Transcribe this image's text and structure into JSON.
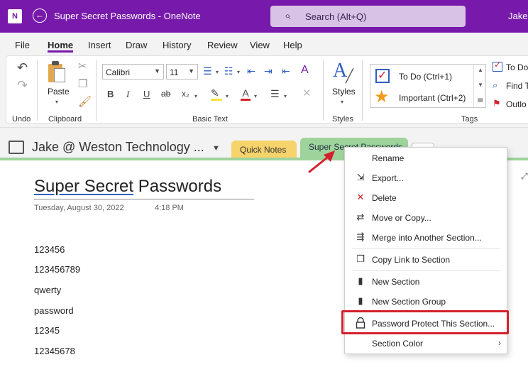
{
  "titlebar": {
    "logo": "N",
    "title": "Super Secret Passwords  -  OneNote",
    "search_placeholder": "Search (Alt+Q)",
    "user": "Jake C"
  },
  "menu": {
    "items": [
      "File",
      "Home",
      "Insert",
      "Draw",
      "History",
      "Review",
      "View",
      "Help"
    ],
    "active": "Home"
  },
  "ribbon": {
    "groups": {
      "undo": "Undo",
      "clipboard": "Clipboard",
      "basic_text": "Basic Text",
      "styles": "Styles",
      "tags": "Tags"
    },
    "paste_label": "Paste",
    "styles_label": "Styles",
    "font_name": "Calibri",
    "font_size": "11",
    "tags": {
      "todo": "To Do (Ctrl+1)",
      "important": "Important (Ctrl+2)"
    },
    "right_items": {
      "todo_tag": "To Do",
      "find_tags": "Find T",
      "outlook": "Outlo"
    }
  },
  "notebook": {
    "name": "Jake @ Weston Technology ...",
    "tabs": {
      "quick_notes": "Quick Notes",
      "secret": "Super Secret Passwords"
    },
    "colors": {
      "quick_notes": "#f6d36b",
      "secret": "#9fd39c"
    }
  },
  "page": {
    "title_part1": "Super Secret",
    "title_part2": " Passwords",
    "date": "Tuesday, August 30, 2022",
    "time": "4:18 PM",
    "lines": [
      "123456",
      "123456789",
      "qwerty",
      "password",
      "12345",
      "12345678"
    ]
  },
  "context_menu": {
    "items": [
      {
        "label": "Rename",
        "icon": "none"
      },
      {
        "label": "Export...",
        "icon": "export-icon"
      },
      {
        "label": "Delete",
        "icon": "delete-x-icon"
      },
      {
        "label": "Move or Copy...",
        "icon": "move-icon"
      },
      {
        "label": "Merge into Another Section...",
        "icon": "merge-icon"
      },
      {
        "label": "Copy Link to Section",
        "icon": "link-icon"
      },
      {
        "label": "New Section",
        "icon": "section-icon"
      },
      {
        "label": "New Section Group",
        "icon": "section-group-icon"
      },
      {
        "label": "Password Protect This Section...",
        "icon": "lock-icon"
      },
      {
        "label": "Section Color",
        "icon": "none"
      }
    ],
    "highlight_color": "#d4202c"
  },
  "theme": {
    "accent": "#7719aa"
  }
}
